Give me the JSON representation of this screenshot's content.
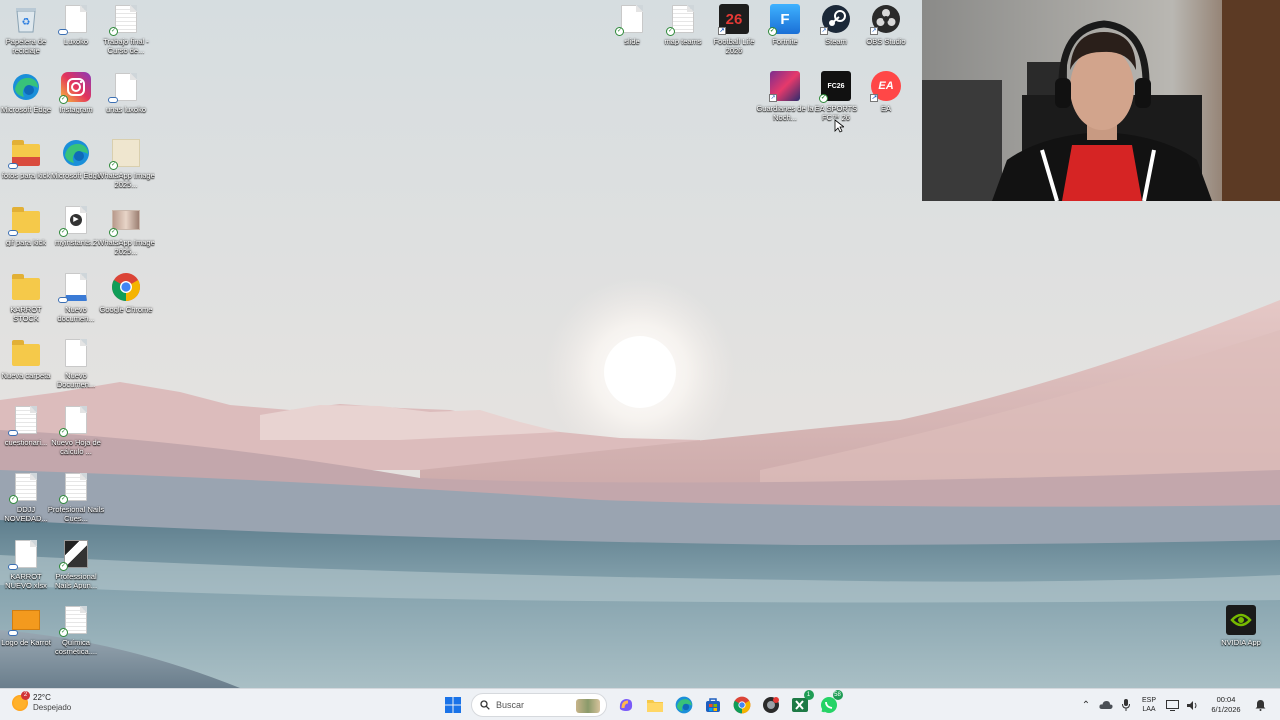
{
  "desktop": {
    "icons_left": [
      {
        "label": "Papelera de reciclaje",
        "icon": "recycle-bin-icon"
      },
      {
        "label": "Luxoko",
        "icon": "document-icon"
      },
      {
        "label": "Trabajo final - Curso de...",
        "icon": "document-icon"
      },
      {
        "label": "Microsoft Edge",
        "icon": "edge-icon"
      },
      {
        "label": "Instagram",
        "icon": "instagram-icon"
      },
      {
        "label": "unas luxoko",
        "icon": "document-icon"
      },
      {
        "label": "fotos para kick",
        "icon": "folder-icon"
      },
      {
        "label": "Microsoft Edge",
        "icon": "edge-icon"
      },
      {
        "label": "WhatsApp Image 2025...",
        "icon": "image-icon"
      },
      {
        "label": "gif para kick",
        "icon": "folder-icon"
      },
      {
        "label": "myinstants.2",
        "icon": "media-icon"
      },
      {
        "label": "WhatsApp Image 2025...",
        "icon": "image-icon"
      },
      {
        "label": "KARROT STOCK",
        "icon": "folder-icon"
      },
      {
        "label": "Nuevo documen...",
        "icon": "document-icon"
      },
      {
        "label": "Google Chrome",
        "icon": "chrome-icon"
      },
      {
        "label": "Nueva carpeta",
        "icon": "folder-icon"
      },
      {
        "label": "Nuevo Documen...",
        "icon": "document-icon"
      },
      {
        "label": "cuestionari...",
        "icon": "document-icon"
      },
      {
        "label": "Nuevo Hoja de cálculo ...",
        "icon": "document-icon"
      },
      {
        "label": "DDJJ NOVEDAD...",
        "icon": "document-icon"
      },
      {
        "label": "Profesional Nails Cues...",
        "icon": "document-icon"
      },
      {
        "label": "KARROT NUEVO.xlsx",
        "icon": "document-icon"
      },
      {
        "label": "Professional Nails Apun...",
        "icon": "image-icon"
      },
      {
        "label": "Logo de Karrot",
        "icon": "image-icon"
      },
      {
        "label": "Química cosmética....",
        "icon": "document-icon"
      }
    ],
    "icons_top": [
      {
        "label": "slide",
        "icon": "document-icon"
      },
      {
        "label": "map teams",
        "icon": "document-icon"
      },
      {
        "label": "Football Life 2026",
        "icon": "game-icon",
        "tile_text": "26"
      },
      {
        "label": "Fortnite",
        "icon": "fortnite-icon",
        "tile_text": "F"
      },
      {
        "label": "Steam",
        "icon": "steam-icon"
      },
      {
        "label": "OBS Studio",
        "icon": "obs-icon"
      },
      {
        "label": "Guardianes de la Noch...",
        "icon": "game-icon"
      },
      {
        "label": "EA SPORTS FC™ 26",
        "icon": "game-icon",
        "tile_text": "FC26"
      },
      {
        "label": "EA",
        "icon": "ea-icon",
        "tile_text": "EA"
      }
    ],
    "nvidia": {
      "label": "NVIDIA App",
      "icon": "nvidia-icon"
    }
  },
  "taskbar": {
    "weather": {
      "temp": "22°C",
      "condition": "Despejado",
      "badge": "2"
    },
    "search_placeholder": "Buscar",
    "apps": [
      {
        "name": "start-button",
        "icon": "windows-icon"
      },
      {
        "name": "copilot-button",
        "icon": "copilot-icon"
      },
      {
        "name": "file-explorer-button",
        "icon": "folder-icon"
      },
      {
        "name": "edge-button",
        "icon": "edge-icon"
      },
      {
        "name": "store-button",
        "icon": "store-icon"
      },
      {
        "name": "chrome-button",
        "icon": "chrome-icon"
      },
      {
        "name": "app-button",
        "icon": "app-icon"
      },
      {
        "name": "excel-button",
        "icon": "excel-icon",
        "badge": "1"
      },
      {
        "name": "whatsapp-button",
        "icon": "whatsapp-icon",
        "badge": "58"
      }
    ],
    "tray": {
      "lang_line1": "ESP",
      "lang_line2": "LAA",
      "time": "00:04",
      "date": "6/1/2026"
    }
  },
  "colors": {
    "taskbar_bg": "#eef1f5",
    "whatsapp_green": "#1f9d55",
    "windows_blue": "#1a73e8"
  }
}
